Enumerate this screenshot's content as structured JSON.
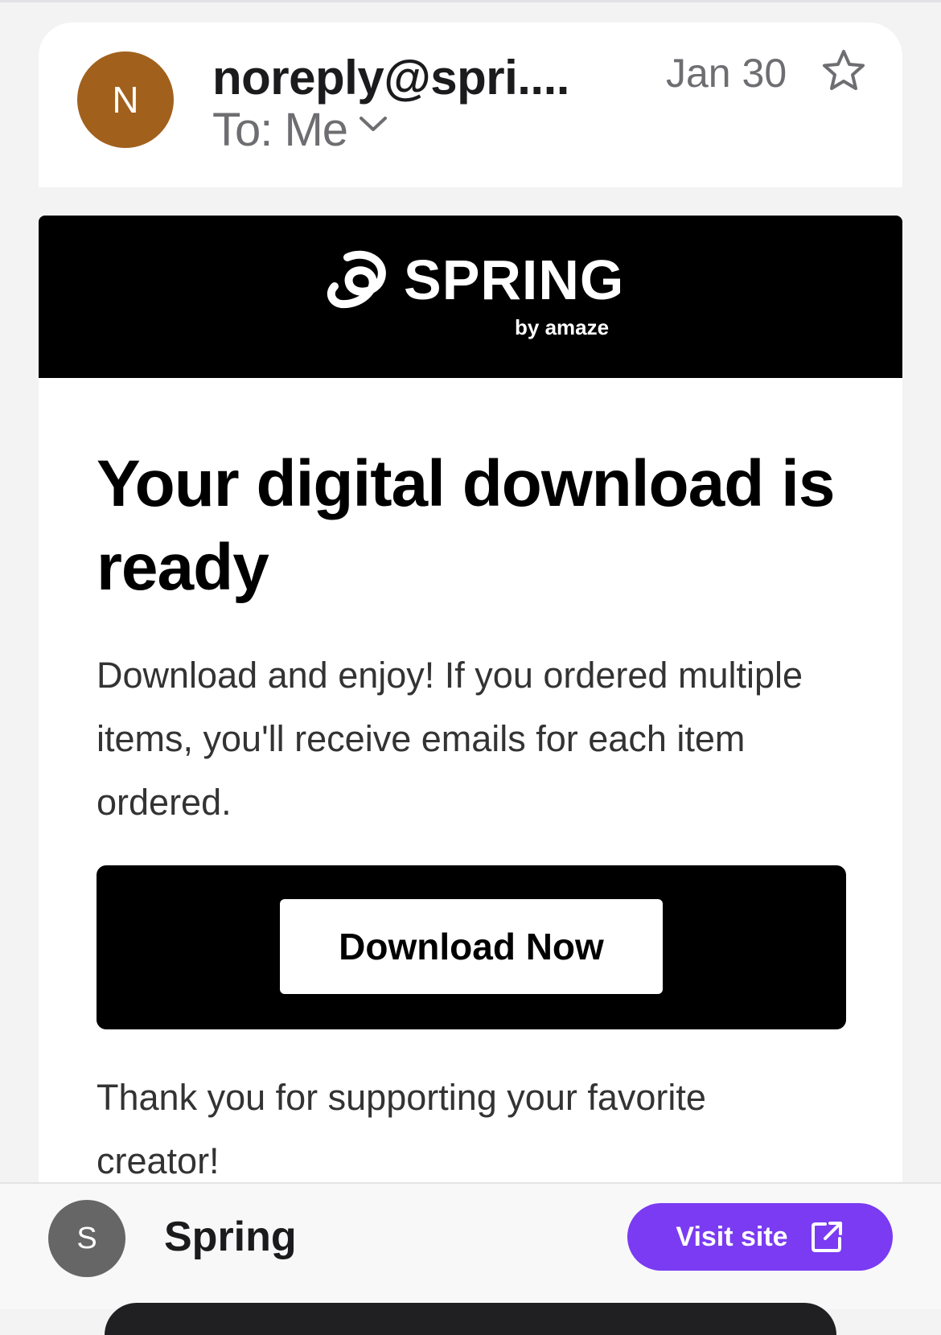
{
  "header": {
    "avatar_initial": "N",
    "sender": "noreply@spri....",
    "recipient": "To: Me",
    "date": "Jan 30"
  },
  "banner": {
    "brand": "SPRING",
    "byline": "by amaze"
  },
  "email": {
    "headline": "Your digital download is ready",
    "intro": "Download and enjoy! If you ordered multiple items, you'll receive emails for each item ordered.",
    "cta_label": "Download Now",
    "thanks": "Thank you for supporting your favorite creator!"
  },
  "sponsor": {
    "avatar_initial": "S",
    "name": "Spring",
    "visit_label": "Visit site"
  },
  "colors": {
    "sender_avatar": "#a1611d",
    "sponsor_avatar": "#666666",
    "visit_button": "#7a3bf2",
    "banner": "#000000"
  },
  "icons": [
    "chevron-down-icon",
    "star-icon",
    "spring-logo-icon",
    "external-link-icon"
  ]
}
